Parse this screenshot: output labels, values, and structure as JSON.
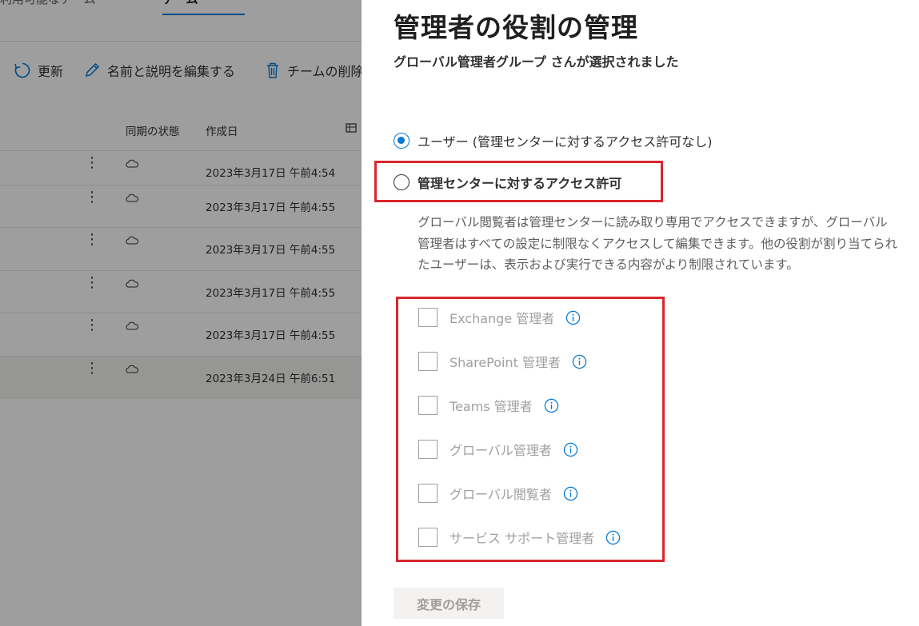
{
  "background": {
    "tabs": [
      {
        "label": "利用可能なチーム"
      },
      {
        "label": "チーム"
      }
    ],
    "commands": {
      "refresh": "更新",
      "edit": "名前と説明を編集する",
      "delete": "チームの削除"
    },
    "columns": {
      "sync": "同期の状態",
      "created": "作成日"
    },
    "rows": [
      {
        "date": "2023年3月17日 午前4:54"
      },
      {
        "date": "2023年3月17日 午前4:55"
      },
      {
        "date": "2023年3月17日 午前4:55"
      },
      {
        "date": "2023年3月17日 午前4:55"
      },
      {
        "date": "2023年3月17日 午前4:55"
      },
      {
        "date": "2023年3月24日 午前6:51"
      }
    ]
  },
  "panel": {
    "title": "管理者の役割の管理",
    "subtitle": "グローバル管理者グループ さんが選択されました",
    "options": [
      {
        "label": "ユーザー (管理センターに対するアクセス許可なし)",
        "checked": true
      },
      {
        "label": "管理センターに対するアクセス許可",
        "checked": false
      }
    ],
    "description": "グローバル閲覧者は管理センターに読み取り専用でアクセスできますが、グローバル管理者はすべての設定に制限なくアクセスして編集できます。他の役割が割り当てられたユーザーは、表示および実行できる内容がより制限されています。",
    "roles": [
      {
        "label": "Exchange 管理者"
      },
      {
        "label": "SharePoint 管理者"
      },
      {
        "label": "Teams 管理者"
      },
      {
        "label": "グローバル管理者"
      },
      {
        "label": "グローバル閲覧者"
      },
      {
        "label": "サービス サポート管理者"
      }
    ],
    "save_label": "変更の保存"
  },
  "colors": {
    "accent": "#0078d4",
    "highlight": "#d9272e",
    "disabled_text": "#a19f9d"
  },
  "icons": [
    "refresh-icon",
    "edit-icon",
    "delete-icon",
    "more-icon",
    "cloud-icon",
    "info-icon"
  ]
}
